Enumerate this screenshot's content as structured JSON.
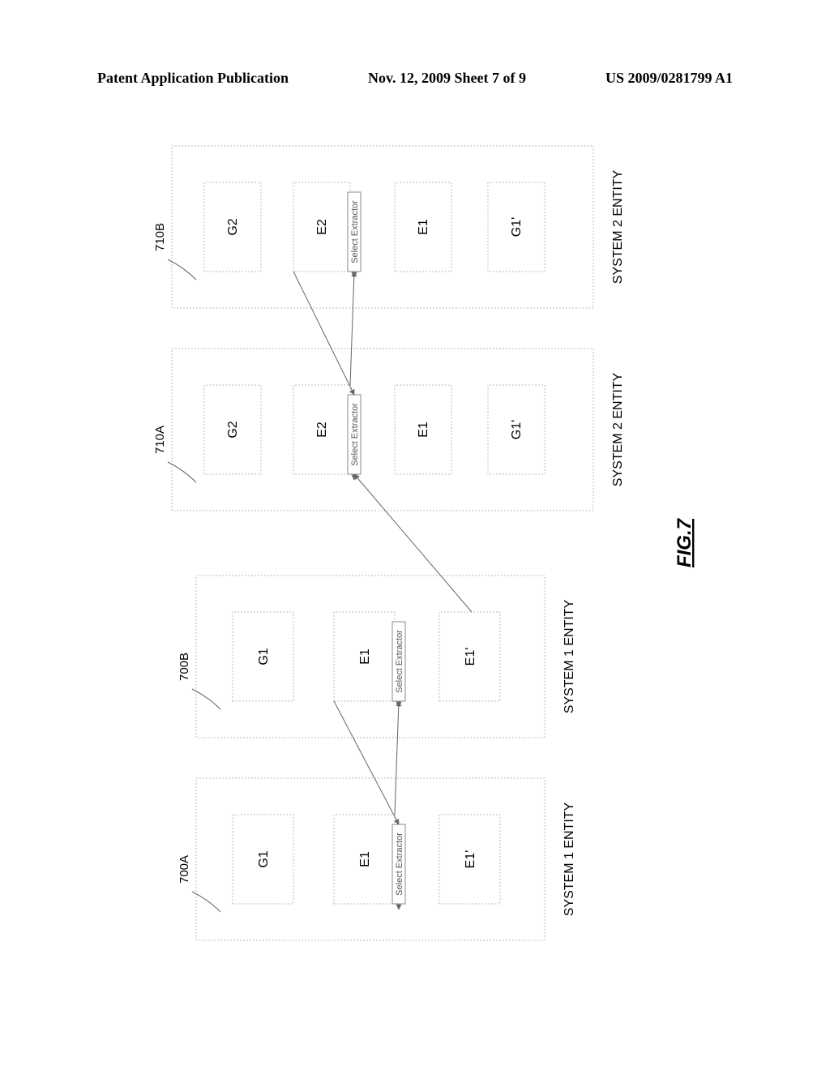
{
  "header": {
    "left": "Patent Application Publication",
    "center": "Nov. 12, 2009  Sheet 7 of 9",
    "right": "US 2009/0281799 A1"
  },
  "figure": {
    "label": "FIG.7",
    "select_extractor": "Select Extractor",
    "entities": {
      "b700A": {
        "ref": "700A",
        "caption": "SYSTEM 1 ENTITY",
        "items": [
          "G1",
          "E1",
          "E1'"
        ]
      },
      "b700B": {
        "ref": "700B",
        "caption": "SYSTEM 1 ENTITY",
        "items": [
          "G1",
          "E1",
          "E1'"
        ]
      },
      "b710A": {
        "ref": "710A",
        "caption": "SYSTEM 2 ENTITY",
        "items": [
          "G2",
          "E2",
          "E1",
          "G1'"
        ]
      },
      "b710B": {
        "ref": "710B",
        "caption": "SYSTEM 2 ENTITY",
        "items": [
          "G2",
          "E2",
          "E1",
          "G1'"
        ]
      }
    }
  }
}
